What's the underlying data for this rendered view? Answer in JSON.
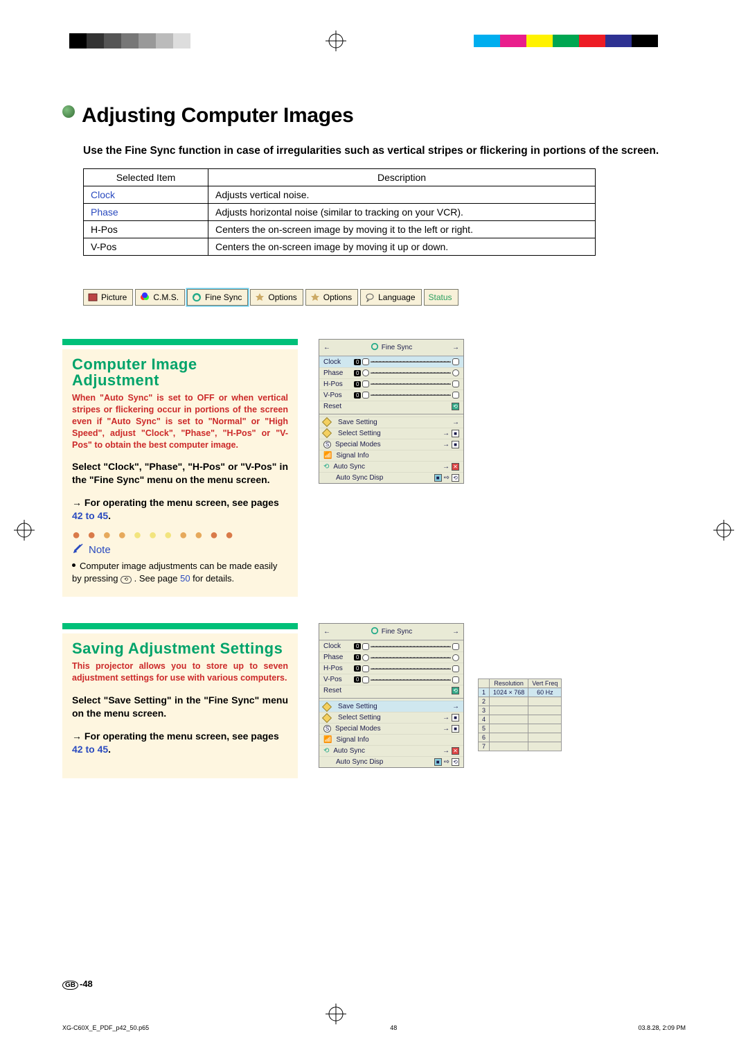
{
  "page": {
    "title": "Adjusting Computer Images",
    "intro": "Use the Fine Sync function in case of irregularities such as vertical stripes or flickering in portions of the screen."
  },
  "table": {
    "headers": [
      "Selected Item",
      "Description"
    ],
    "rows": [
      {
        "item": "Clock",
        "itemClass": "blue-link",
        "desc": "Adjusts vertical noise."
      },
      {
        "item": "Phase",
        "itemClass": "blue-link",
        "desc": "Adjusts horizontal noise (similar to tracking on your VCR)."
      },
      {
        "item": "H-Pos",
        "itemClass": "",
        "desc": "Centers the on-screen image by moving it to the left or right."
      },
      {
        "item": "V-Pos",
        "itemClass": "",
        "desc": "Centers the on-screen image by moving it up or down."
      }
    ]
  },
  "tabs": [
    "Picture",
    "C.M.S.",
    "Fine Sync",
    "Options",
    "Options",
    "Language",
    "Status"
  ],
  "selected_tab_index": 2,
  "section1": {
    "title": "Computer Image Adjustment",
    "red": "When \"Auto Sync\" is set to OFF or when vertical stripes or flickering occur in portions of the screen even if \"Auto Sync\" is set to \"Normal\" or \"High Speed\", adjust \"Clock\", \"Phase\", \"H-Pos\" or \"V-Pos\" to obtain the best computer image.",
    "bold": "Select \"Clock\", \"Phase\", \"H-Pos\" or \"V-Pos\" in the \"Fine Sync\" menu on the menu screen.",
    "arrow": "→ For operating the menu screen, see pages ",
    "arrow_link": "42 to 45",
    "arrow_tail": ".",
    "note_label": "Note",
    "note_body_pre": "Computer image adjustments can be made easily by pressing ",
    "note_button": "AUTO SYNC",
    "note_body_mid": ". See page ",
    "note_page": "50",
    "note_body_post": " for details."
  },
  "section2": {
    "title": "Saving Adjustment Settings",
    "red": "This projector allows you to store up to seven adjustment settings for use with various computers.",
    "bold": "Select \"Save Setting\" in the \"Fine Sync\" menu on the menu screen.",
    "arrow": "→ For operating the menu screen, see pages ",
    "arrow_link": "42 to 45",
    "arrow_tail": "."
  },
  "osd": {
    "title": "Fine Sync",
    "rows": [
      "Clock",
      "Phase",
      "H-Pos",
      "V-Pos"
    ],
    "reset": "Reset",
    "items": [
      "Save Setting",
      "Select Setting",
      "Special Modes",
      "Signal Info",
      "Auto Sync",
      "Auto Sync Disp"
    ]
  },
  "restable": {
    "headers": [
      "",
      "Resolution",
      "Vert Freq"
    ],
    "rows": [
      [
        "1",
        "1024 × 768",
        "60 Hz"
      ],
      [
        "2",
        "",
        ""
      ],
      [
        "3",
        "",
        ""
      ],
      [
        "4",
        "",
        ""
      ],
      [
        "5",
        "",
        ""
      ],
      [
        "6",
        "",
        ""
      ],
      [
        "7",
        "",
        ""
      ]
    ]
  },
  "footer": {
    "pageno": "-48",
    "filename": "XG-C60X_E_PDF_p42_50.p65",
    "filepage": "48",
    "timestamp": "03.8.28, 2:09 PM"
  }
}
